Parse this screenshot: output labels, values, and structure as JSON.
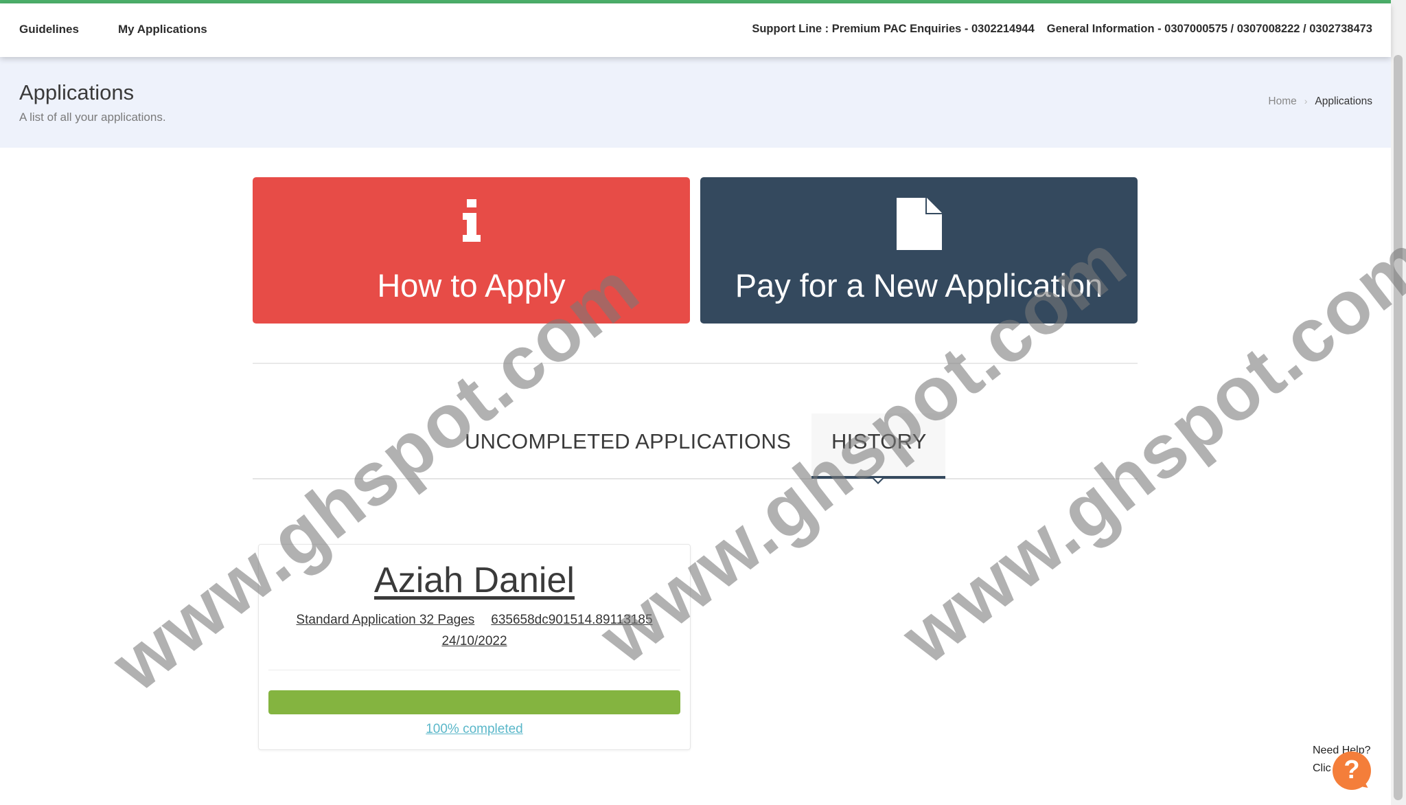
{
  "nav": {
    "links": [
      "Guidelines",
      "My Applications"
    ],
    "support_line": "Support Line : Premium PAC Enquiries - 0302214944",
    "general_info": "General Information - 0307000575 / 0307008222 / 0302738473"
  },
  "header": {
    "title": "Applications",
    "subtitle": "A list of all your applications.",
    "breadcrumb": {
      "home": "Home",
      "current": "Applications"
    }
  },
  "actions": {
    "how_to_apply": "How to Apply",
    "pay_new": "Pay for a New Application"
  },
  "tabs": {
    "uncompleted": "UNCOMPLETED APPLICATIONS",
    "history": "HISTORY",
    "active": "history"
  },
  "application": {
    "name": "Aziah Daniel",
    "type": "Standard Application 32 Pages",
    "reference": "635658dc901514.89113185",
    "date": "24/10/2022",
    "progress_percent": 100,
    "progress_label": "100% completed"
  },
  "help": {
    "line1": "Need Help?",
    "line2": "Clic",
    "button_glyph": "?"
  },
  "watermark": "www.ghspot.com",
  "colors": {
    "how_to_apply_bg": "#e74c47",
    "pay_new_bg": "#34495e",
    "progress": "#84b440",
    "help_button": "#f47e3a",
    "header_bg": "#eef2fb"
  },
  "icons": {
    "how_to_apply": "info-icon",
    "pay_new": "document-icon",
    "breadcrumb_separator": "chevron-right-icon"
  }
}
